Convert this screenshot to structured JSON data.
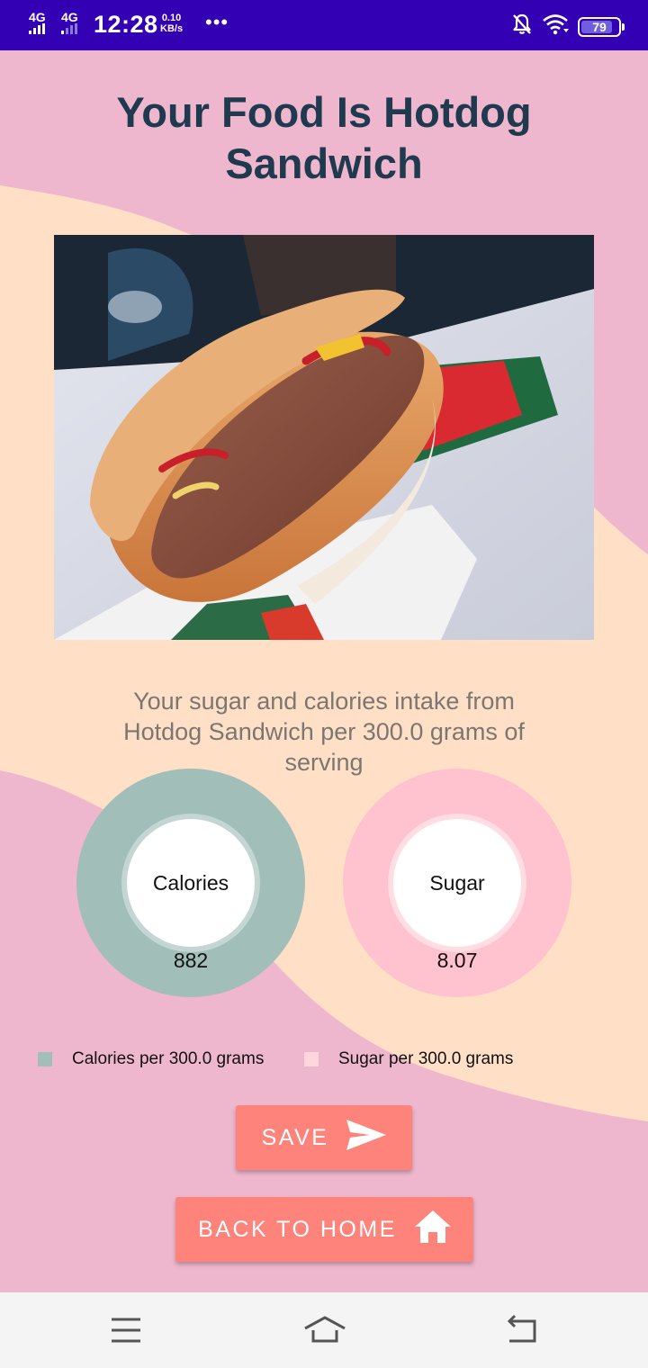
{
  "status_bar": {
    "net1": "4G",
    "net2": "4G",
    "time": "12:28",
    "speed_value": "0.10",
    "speed_unit": "KB/s",
    "more": "•••",
    "battery_level": "79",
    "icons": [
      "signal-icon",
      "mute-bell-icon",
      "wifi-icon",
      "battery-icon"
    ]
  },
  "page": {
    "title": "Your Food Is Hotdog Sandwich",
    "image_alt": "hotdog-photo"
  },
  "intake": {
    "text": "Your sugar and calories intake from Hotdog Sandwich per 300.0 grams of serving"
  },
  "chart_data": {
    "type": "pie",
    "series": [
      {
        "name": "Calories",
        "values": [
          882
        ]
      },
      {
        "name": "Sugar",
        "values": [
          8.07
        ]
      }
    ],
    "legend": [
      "Calories per 300.0 grams",
      "Sugar per 300.0 grams"
    ],
    "legend_position": "bottom"
  },
  "donuts": {
    "calories": {
      "label": "Calories",
      "value": "882",
      "color": "#a2beb9"
    },
    "sugar": {
      "label": "Sugar",
      "value": "8.07",
      "color": "#ffc2cf"
    }
  },
  "legend": {
    "calories": {
      "label": "Calories per 300.0 grams",
      "color": "#a2beb9"
    },
    "sugar": {
      "label": "Sugar per 300.0 grams",
      "color": "#ffd6dd"
    }
  },
  "buttons": {
    "save": "SAVE",
    "home": "BACK TO HOME"
  },
  "colors": {
    "status_bar": "#3300b3",
    "background_peach": "#ffe0c6",
    "background_pink": "#eeb7cd",
    "title": "#1f3a4f",
    "button": "#fd837b"
  }
}
